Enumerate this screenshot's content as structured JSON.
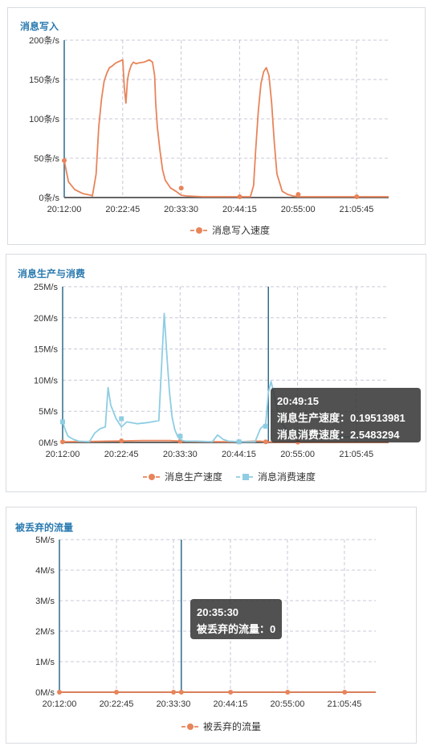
{
  "colors": {
    "write": "#e8845a",
    "produce": "#e8845a",
    "consume": "#8ecde3",
    "axis": "#2e6b8c",
    "grid": "#c8c8d8",
    "title": "#2a7ab0"
  },
  "chart_data": [
    {
      "type": "line",
      "title": "消息写入",
      "y_ticks": [
        "0条/s",
        "50条/s",
        "100条/s",
        "150条/s",
        "200条/s"
      ],
      "ylim": [
        0,
        200
      ],
      "x_ticks": [
        "20:12:00",
        "20:22:45",
        "20:33:30",
        "20:44:15",
        "20:55:00",
        "21:05:45"
      ],
      "xlim": [
        0,
        61
      ],
      "grid": true,
      "legend": "bottom-center",
      "series": [
        {
          "name": "消息写入速度",
          "x": [
            0,
            0.8,
            2,
            3.5,
            5,
            5.3,
            6,
            6.5,
            7,
            7.5,
            8,
            8.5,
            9,
            9.5,
            10,
            11,
            11.3,
            11.6,
            11.9,
            12.2,
            12.6,
            13,
            13.5,
            14,
            15,
            16,
            16.6,
            17,
            17.2,
            17.5,
            18,
            18.5,
            19,
            20,
            21,
            22,
            23,
            26,
            30,
            33,
            35,
            35.6,
            36,
            36.5,
            37,
            37.5,
            38,
            38.5,
            39,
            39.5,
            40,
            41,
            42,
            43,
            44,
            46,
            50,
            55,
            58,
            61
          ],
          "y": [
            47,
            20,
            10,
            5,
            3,
            2,
            30,
            90,
            125,
            148,
            158,
            165,
            167,
            170,
            172,
            175,
            140,
            120,
            150,
            160,
            168,
            172,
            170,
            171,
            172,
            175,
            172,
            155,
            120,
            90,
            60,
            35,
            22,
            12,
            8,
            3,
            2,
            1,
            1,
            1,
            1,
            15,
            60,
            110,
            145,
            160,
            165,
            155,
            120,
            70,
            30,
            8,
            4,
            2,
            1,
            1,
            1,
            1,
            1,
            1
          ],
          "marked_points": [
            [
              0,
              47
            ],
            [
              22,
              12
            ],
            [
              33,
              1
            ],
            [
              44,
              4
            ],
            [
              55,
              1
            ]
          ]
        }
      ]
    },
    {
      "type": "line",
      "title": "消息生产与消费",
      "y_ticks": [
        "0M/s",
        "5M/s",
        "10M/s",
        "15M/s",
        "20M/s",
        "25M/s"
      ],
      "ylim": [
        0,
        25
      ],
      "x_ticks": [
        "20:12:00",
        "20:22:45",
        "20:33:30",
        "20:44:15",
        "20:55:00",
        "21:05:45"
      ],
      "xlim": [
        0,
        61
      ],
      "grid": true,
      "legend": "bottom-center",
      "series": [
        {
          "name": "消息生产速度",
          "x": [
            0,
            5,
            8,
            11,
            15,
            20,
            22,
            25,
            30,
            33,
            36,
            37,
            38,
            40,
            45,
            50,
            55,
            61
          ],
          "y": [
            0.1,
            0.15,
            0.2,
            0.25,
            0.3,
            0.3,
            0.2,
            0.15,
            0.1,
            0.1,
            0.2,
            0.2,
            0.1,
            0.05,
            0.05,
            0.05,
            0.05,
            0.05
          ],
          "marked_points": [
            [
              0,
              0.1
            ],
            [
              11,
              0.25
            ],
            [
              22,
              0.2
            ],
            [
              33,
              0.1
            ],
            [
              38,
              0.1
            ],
            [
              44,
              0.05
            ]
          ]
        },
        {
          "name": "消息消费速度",
          "x": [
            0,
            0.5,
            1,
            2,
            3,
            5,
            6,
            7,
            8,
            8.5,
            9,
            10,
            11,
            12,
            14,
            16,
            18,
            18.5,
            19,
            19.5,
            20,
            20.5,
            21,
            21.5,
            22,
            22.5,
            23,
            25,
            28,
            29,
            30,
            31,
            33,
            36,
            37,
            37.5,
            38,
            38.5,
            39,
            40,
            41,
            42,
            45,
            50,
            55,
            61
          ],
          "y": [
            3.3,
            2,
            1,
            0.5,
            0.2,
            0.1,
            1.5,
            2.2,
            2.5,
            8.8,
            6,
            3.8,
            2.5,
            3.3,
            3,
            3.2,
            3.5,
            12,
            20.7,
            14,
            8,
            4,
            2,
            1,
            0.5,
            0.3,
            0.2,
            0.2,
            0.1,
            1.2,
            0.5,
            0.2,
            0.1,
            0.1,
            2.2,
            2.6,
            3,
            8,
            9.8,
            6,
            3,
            2,
            1.5,
            1,
            0.8,
            0.5
          ],
          "marked_points": [
            [
              0,
              3.3
            ],
            [
              11,
              3.8
            ],
            [
              22,
              1
            ],
            [
              33,
              0.1
            ],
            [
              38,
              2.6
            ]
          ]
        }
      ],
      "cursor_x": 38.5,
      "tooltip": {
        "time": "20:49:15",
        "produce_line": "消息生产速度：0.19513981",
        "consume_line": "消息消费速度：2.5483294"
      }
    },
    {
      "type": "line",
      "title": "被丢弃的流量",
      "y_ticks": [
        "0M/s",
        "1M/s",
        "2M/s",
        "3M/s",
        "4M/s",
        "5M/s"
      ],
      "ylim": [
        0,
        5
      ],
      "x_ticks": [
        "20:12:00",
        "20:22:45",
        "20:33:30",
        "20:44:15",
        "20:55:00",
        "21:05:45"
      ],
      "xlim": [
        0,
        61
      ],
      "grid": true,
      "legend": "bottom-center",
      "series": [
        {
          "name": "被丢弃的流量",
          "x": [
            0,
            61
          ],
          "y": [
            0,
            0
          ],
          "marked_points": [
            [
              0,
              0
            ],
            [
              11,
              0
            ],
            [
              22,
              0
            ],
            [
              23.5,
              0
            ],
            [
              33,
              0
            ],
            [
              44,
              0
            ],
            [
              55,
              0
            ]
          ]
        }
      ],
      "cursor_x": 23.5,
      "tooltip": {
        "time": "20:35:30",
        "line": "被丢弃的流量：0"
      }
    }
  ]
}
